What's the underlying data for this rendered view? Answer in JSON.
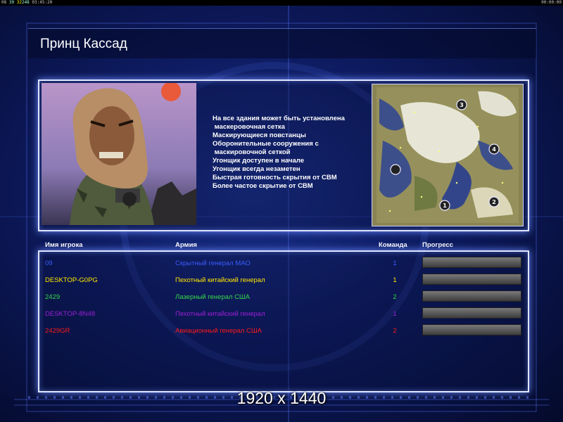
{
  "topbar": {
    "fps_a": "08",
    "fps_b": "30",
    "fps_c": "32",
    "fps_d": "248",
    "time": "03:45:20",
    "clock": "00:00:00"
  },
  "title": "Принц Кассад",
  "features": [
    "На все здания может быть установлена",
    " маскеровочная сетка",
    "Маскирующиеся повстанцы",
    "Оборонительные сооружения с",
    " маскировочной сеткой",
    "Угонщик доступен в начале",
    "Угонщик всегда незаметен",
    "Быстрая готовность скрытия от СВМ",
    "Более частое скрытие от СВМ"
  ],
  "columns": {
    "name": "Имя игрока",
    "army": "Армия",
    "team": "Команда",
    "progress": "Прогресс"
  },
  "players": [
    {
      "name": "09",
      "army": "Скрытный генерал МАО",
      "team": "1",
      "color": "#3a5bff",
      "progress": 1.0
    },
    {
      "name": "DESKTOP-G0PG",
      "army": "Пехотный китайский генерал",
      "team": "1",
      "color": "#ffe600",
      "progress": 1.0
    },
    {
      "name": "2429",
      "army": "Лазерный генерал США",
      "team": "2",
      "color": "#36d948",
      "progress": 1.0
    },
    {
      "name": "DESKTOP-8N48",
      "army": "Пехотный китайский генерал",
      "team": "1",
      "color": "#9d1fd6",
      "progress": 1.0
    },
    {
      "name": "2429GR",
      "army": "Авиационный генерал США",
      "team": "2",
      "color": "#ff1a1a",
      "progress": 1.0
    }
  ],
  "minimap_markers": [
    "1",
    "2",
    "3",
    "4"
  ],
  "resolution": "1920 x 1440",
  "colors": {
    "panel_border": "#dfe6ff",
    "glow": "#6d8cff",
    "background": "#0d1a5e"
  }
}
